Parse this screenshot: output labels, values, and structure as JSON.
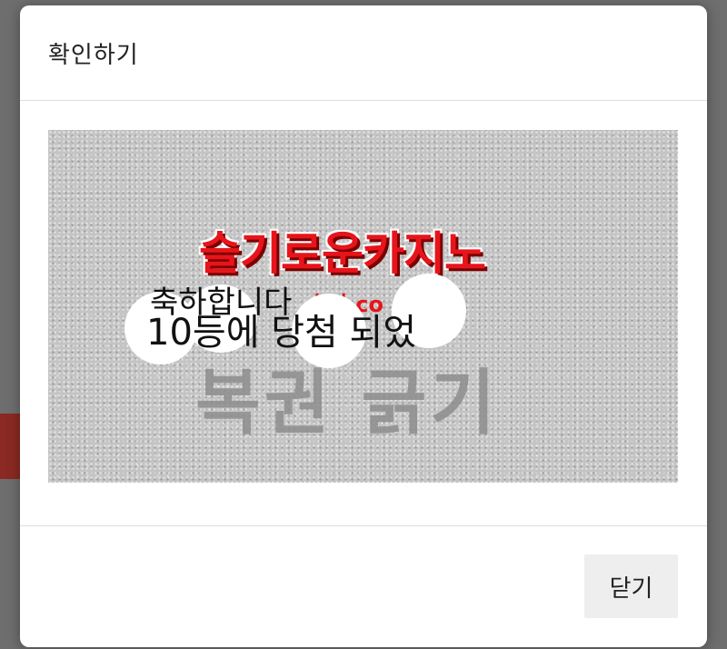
{
  "dialog": {
    "title": "확인하기",
    "close_label": "닫기"
  },
  "scratch_card": {
    "brand": "슬기로운카지노",
    "brand_sub": "슬기.co",
    "background_text": "복권 긁기",
    "revealed_line_1": "축하합니다",
    "revealed_line_2": "10등에 당첨 되었"
  }
}
